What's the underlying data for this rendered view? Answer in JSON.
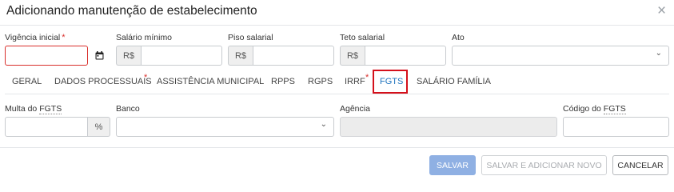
{
  "dialog": {
    "title": "Adicionando manutenção de estabelecimento",
    "close_glyph": "×"
  },
  "fields_row1": {
    "vigencia": {
      "label": "Vigência inicial",
      "required": "*",
      "value": "",
      "error": true,
      "icon": "calendar-icon"
    },
    "salario_minimo": {
      "label": "Salário mínimo",
      "prefix": "R$",
      "value": ""
    },
    "piso_salarial": {
      "label": "Piso salarial",
      "prefix": "R$",
      "value": ""
    },
    "teto_salarial": {
      "label": "Teto salarial",
      "prefix": "R$",
      "value": ""
    },
    "ato": {
      "label": "Ato",
      "value": "",
      "caret": "⌄"
    }
  },
  "tabs": [
    {
      "label": "GERAL",
      "required": false,
      "active": false
    },
    {
      "label": "DADOS PROCESSUAIS",
      "required": true,
      "active": false
    },
    {
      "label": "ASSISTÊNCIA MUNICIPAL",
      "required": false,
      "active": false
    },
    {
      "label": "RPPS",
      "required": false,
      "active": false
    },
    {
      "label": "RGPS",
      "required": false,
      "active": false
    },
    {
      "label": "IRRF",
      "required": true,
      "active": false
    },
    {
      "label": "FGTS",
      "required": false,
      "active": true
    },
    {
      "label": "SALÁRIO FAMÍLIA",
      "required": false,
      "active": false
    }
  ],
  "tab_required_mark": "*",
  "fields_row2": {
    "multa": {
      "label_prefix": "Multa do ",
      "label_abbr": "FGTS",
      "suffix": "%",
      "value": ""
    },
    "banco": {
      "label": "Banco",
      "value": "",
      "caret": "⌄"
    },
    "agencia": {
      "label": "Agência",
      "value": "",
      "disabled": true
    },
    "codigo": {
      "label_prefix": "Código do ",
      "label_abbr": "FGTS",
      "value": ""
    }
  },
  "footer": {
    "save_label": "SALVAR",
    "save_add_label": "SALVAR E ADICIONAR NOVO",
    "cancel_label": "CANCELAR"
  },
  "colors": {
    "accent": "#1e73be",
    "error": "#d9302c",
    "highlight": "#d4101b",
    "primary_disabled": "#8fb0e3"
  }
}
